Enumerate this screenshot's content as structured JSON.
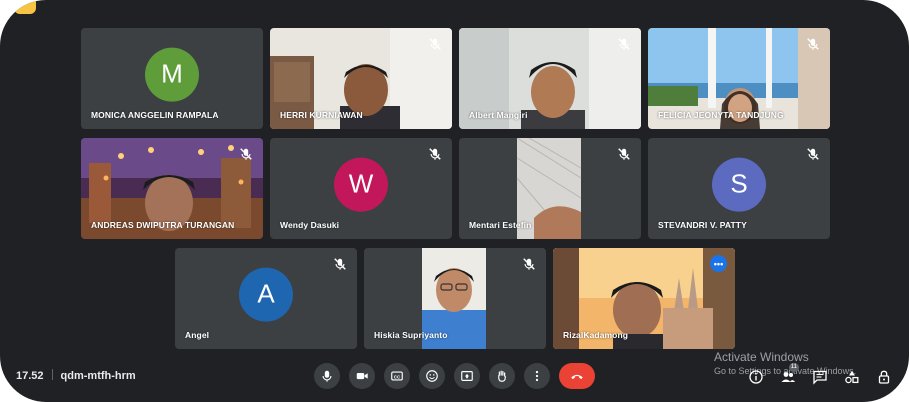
{
  "meeting": {
    "time": "17.52",
    "code": "qdm-mtfh-hrm"
  },
  "participants": [
    {
      "name": "MONICA ANGGELIN RAMPALA",
      "initial": "M",
      "avatar_color": "#5f9c3a"
    },
    {
      "name": "HERRI KURNIAWAN"
    },
    {
      "name": "Albert Mangiri"
    },
    {
      "name": "FELICIA JEONYTA TANDJUNG"
    },
    {
      "name": "ANDREAS DWIPUTRA TURANGAN"
    },
    {
      "name": "Wendy Dasuki",
      "initial": "W",
      "avatar_color": "#c2185b"
    },
    {
      "name": "Mentari Estefin"
    },
    {
      "name": "STEVANDRI V. PATTY",
      "initial": "S",
      "avatar_color": "#5c6bc0"
    },
    {
      "name": "Angel",
      "initial": "A",
      "avatar_color": "#1e66b0"
    },
    {
      "name": "Hiskia Supriyanto"
    },
    {
      "name": "RizalKadamong"
    }
  ],
  "controls": [
    "mic-icon",
    "camera-icon",
    "captions-icon",
    "emoji-icon",
    "present-icon",
    "raise-hand-icon",
    "more-options-icon",
    "end-call-icon"
  ],
  "people_count": "11",
  "watermark": {
    "line1": "Activate Windows",
    "line2": "Go to Settings to activate Windows."
  },
  "colors": {
    "background": "#202124",
    "tile": "#3c4043",
    "active_border": "#8ab4f8",
    "end_call": "#ea4335"
  }
}
